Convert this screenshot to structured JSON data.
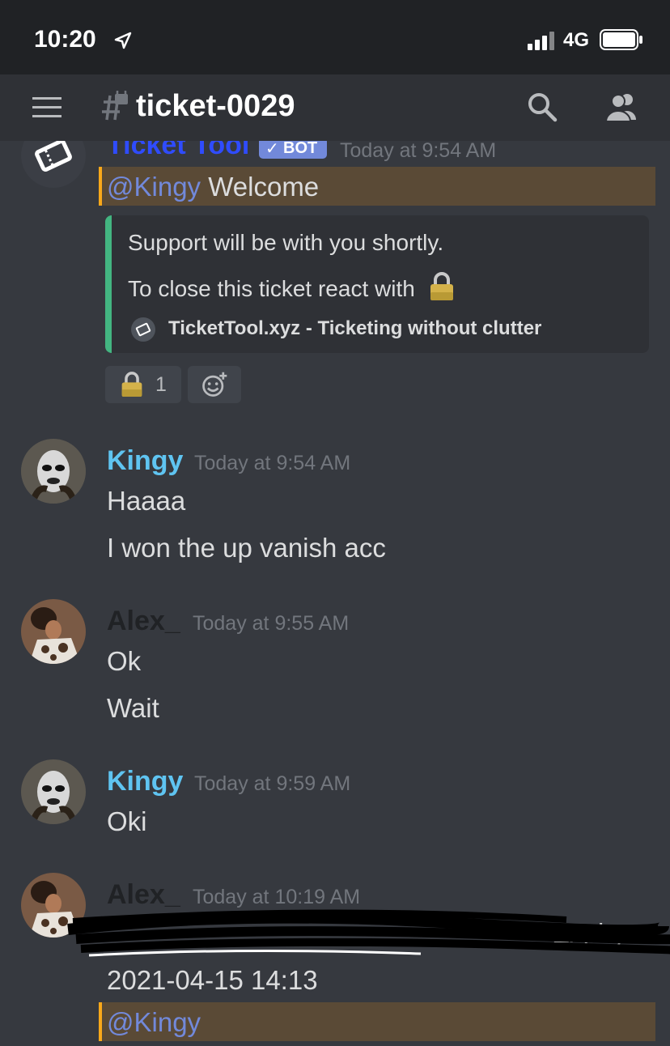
{
  "status_bar": {
    "time": "10:20",
    "network": "4G"
  },
  "header": {
    "channel_name": "ticket-0029"
  },
  "messages": [
    {
      "author": "Ticket Tool",
      "badge": "BOT",
      "timestamp": "Today at 9:54 AM",
      "mention": "@Kingy",
      "mention_text": " Welcome",
      "embed": {
        "line1": "Support will be with you shortly.",
        "line2": "To close this ticket react with",
        "footer": "TicketTool.xyz - Ticketing without clutter"
      },
      "reaction_count": "1"
    },
    {
      "author": "Kingy",
      "timestamp": "Today at 9:54 AM",
      "lines": [
        "Haaaa",
        "I won the up vanish acc"
      ]
    },
    {
      "author": "Alex_",
      "timestamp": "Today at 9:55 AM",
      "lines": [
        "Ok",
        "Wait"
      ]
    },
    {
      "author": "Kingy",
      "timestamp": "Today at 9:59 AM",
      "lines": [
        "Oki"
      ]
    },
    {
      "author": "Alex_",
      "timestamp": "Today at 10:19 AM",
      "redacted_tail": "* - Expiry:",
      "lines": [
        "2021-04-15 14:13"
      ],
      "mention": "@Kingy"
    }
  ],
  "colors": {
    "background": "#36393f",
    "header": "#2f3136",
    "statusbar": "#202225",
    "kingy_name": "#5fc4f1",
    "alex_name": "#202225",
    "bot_name": "#2f4cff",
    "mention_bg": "#5a4a36",
    "mention_border": "#faa81a",
    "embed_border": "#43b581",
    "bot_badge": "#7289da"
  },
  "icons": [
    "location-arrow-icon",
    "signal-icon",
    "battery-icon",
    "hamburger-menu-icon",
    "locked-channel-icon",
    "search-icon",
    "members-icon",
    "ticket-icon",
    "lock-emoji-icon",
    "add-reaction-icon"
  ]
}
